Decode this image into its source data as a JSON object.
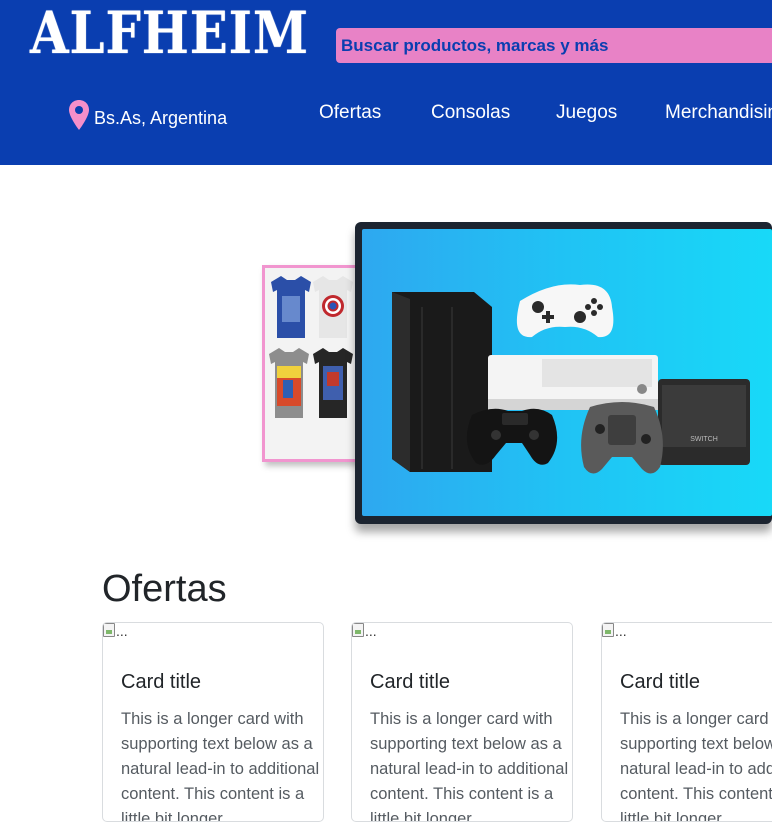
{
  "brand": {
    "name": "ALFHEIM"
  },
  "search": {
    "placeholder": "Buscar productos, marcas y más"
  },
  "location": {
    "icon": "map-pin-icon",
    "label": "Bs.As, Argentina"
  },
  "nav": {
    "items": [
      {
        "label": "Ofertas"
      },
      {
        "label": "Consolas"
      },
      {
        "label": "Juegos"
      },
      {
        "label": "Merchandising"
      }
    ]
  },
  "hero": {
    "slides": [
      {
        "name": "tshirts-promo"
      },
      {
        "name": "consoles-promo"
      }
    ]
  },
  "offers": {
    "title": "Ofertas",
    "cards": [
      {
        "image_alt": "...",
        "title": "Card title",
        "text": "This is a longer card with supporting text below as a natural lead-in to additional content. This content is a little bit longer."
      },
      {
        "image_alt": "...",
        "title": "Card title",
        "text": "This is a longer card with supporting text below as a natural lead-in to additional content. This content is a little bit longer."
      },
      {
        "image_alt": "...",
        "title": "Card title",
        "text": "This is a longer card with supporting text below as a natural lead-in to additional content. This content is a little bit longer."
      }
    ]
  },
  "colors": {
    "header_bg": "#0a3eb0",
    "search_bg": "#e882c6",
    "accent_pink": "#f195cf",
    "text": "#212529"
  }
}
